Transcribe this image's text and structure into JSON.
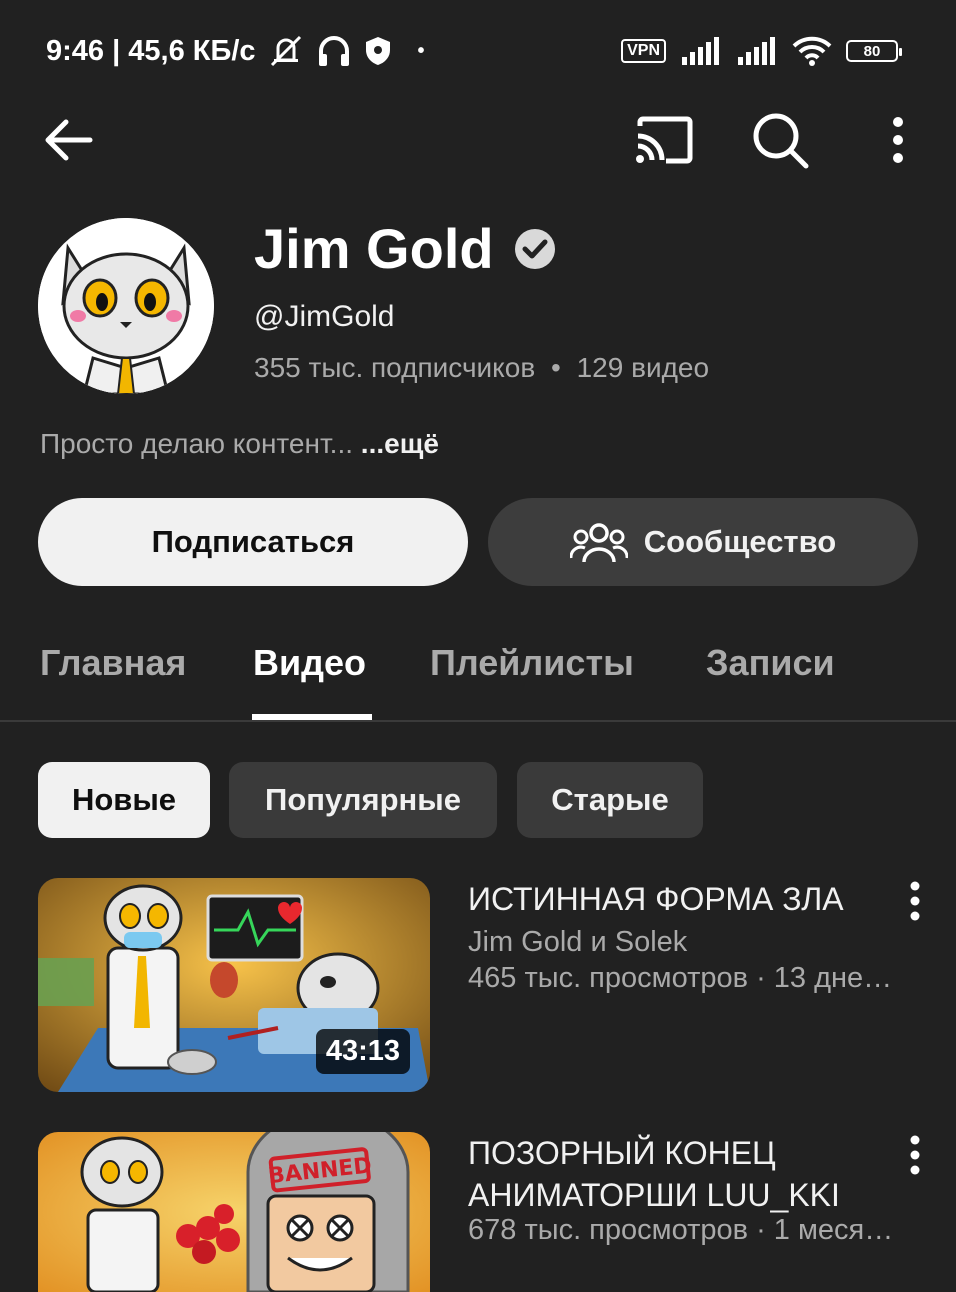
{
  "status_bar": {
    "time_speed": "9:46 | 45,6 КБ/с",
    "vpn": "VPN",
    "battery": "80",
    "icons": [
      "mute-icon",
      "headphones-icon",
      "shield-icon",
      "signal-icon",
      "wifi-icon",
      "battery-icon"
    ]
  },
  "channel": {
    "name": "Jim Gold",
    "handle": "@JimGold",
    "subscribers": "355 тыс. подписчиков",
    "separator": "•",
    "videos_count": "129 видео",
    "description": "Просто делаю контент...",
    "more": "...ещё"
  },
  "actions": {
    "subscribe": "Подписаться",
    "community": "Сообщество"
  },
  "tabs": [
    {
      "label": "Главная",
      "active": false
    },
    {
      "label": "Видео",
      "active": true
    },
    {
      "label": "Плейлисты",
      "active": false
    },
    {
      "label": "Записи",
      "active": false
    }
  ],
  "filters": [
    {
      "label": "Новые",
      "selected": true
    },
    {
      "label": "Популярные",
      "selected": false
    },
    {
      "label": "Старые",
      "selected": false
    }
  ],
  "videos": [
    {
      "title": "ИСТИННАЯ ФОРМА ЗЛА",
      "author": "Jim Gold и Solek",
      "meta": "465 тыс. просмотров · 13 дне…",
      "duration": "43:13"
    },
    {
      "title_line1": "ПОЗОРНЫЙ КОНЕЦ",
      "title_line2": "АНИМАТОРШИ LUU_KKI",
      "meta": "678 тыс. просмотров · 1 меся…",
      "stamp": "BANNED"
    }
  ]
}
